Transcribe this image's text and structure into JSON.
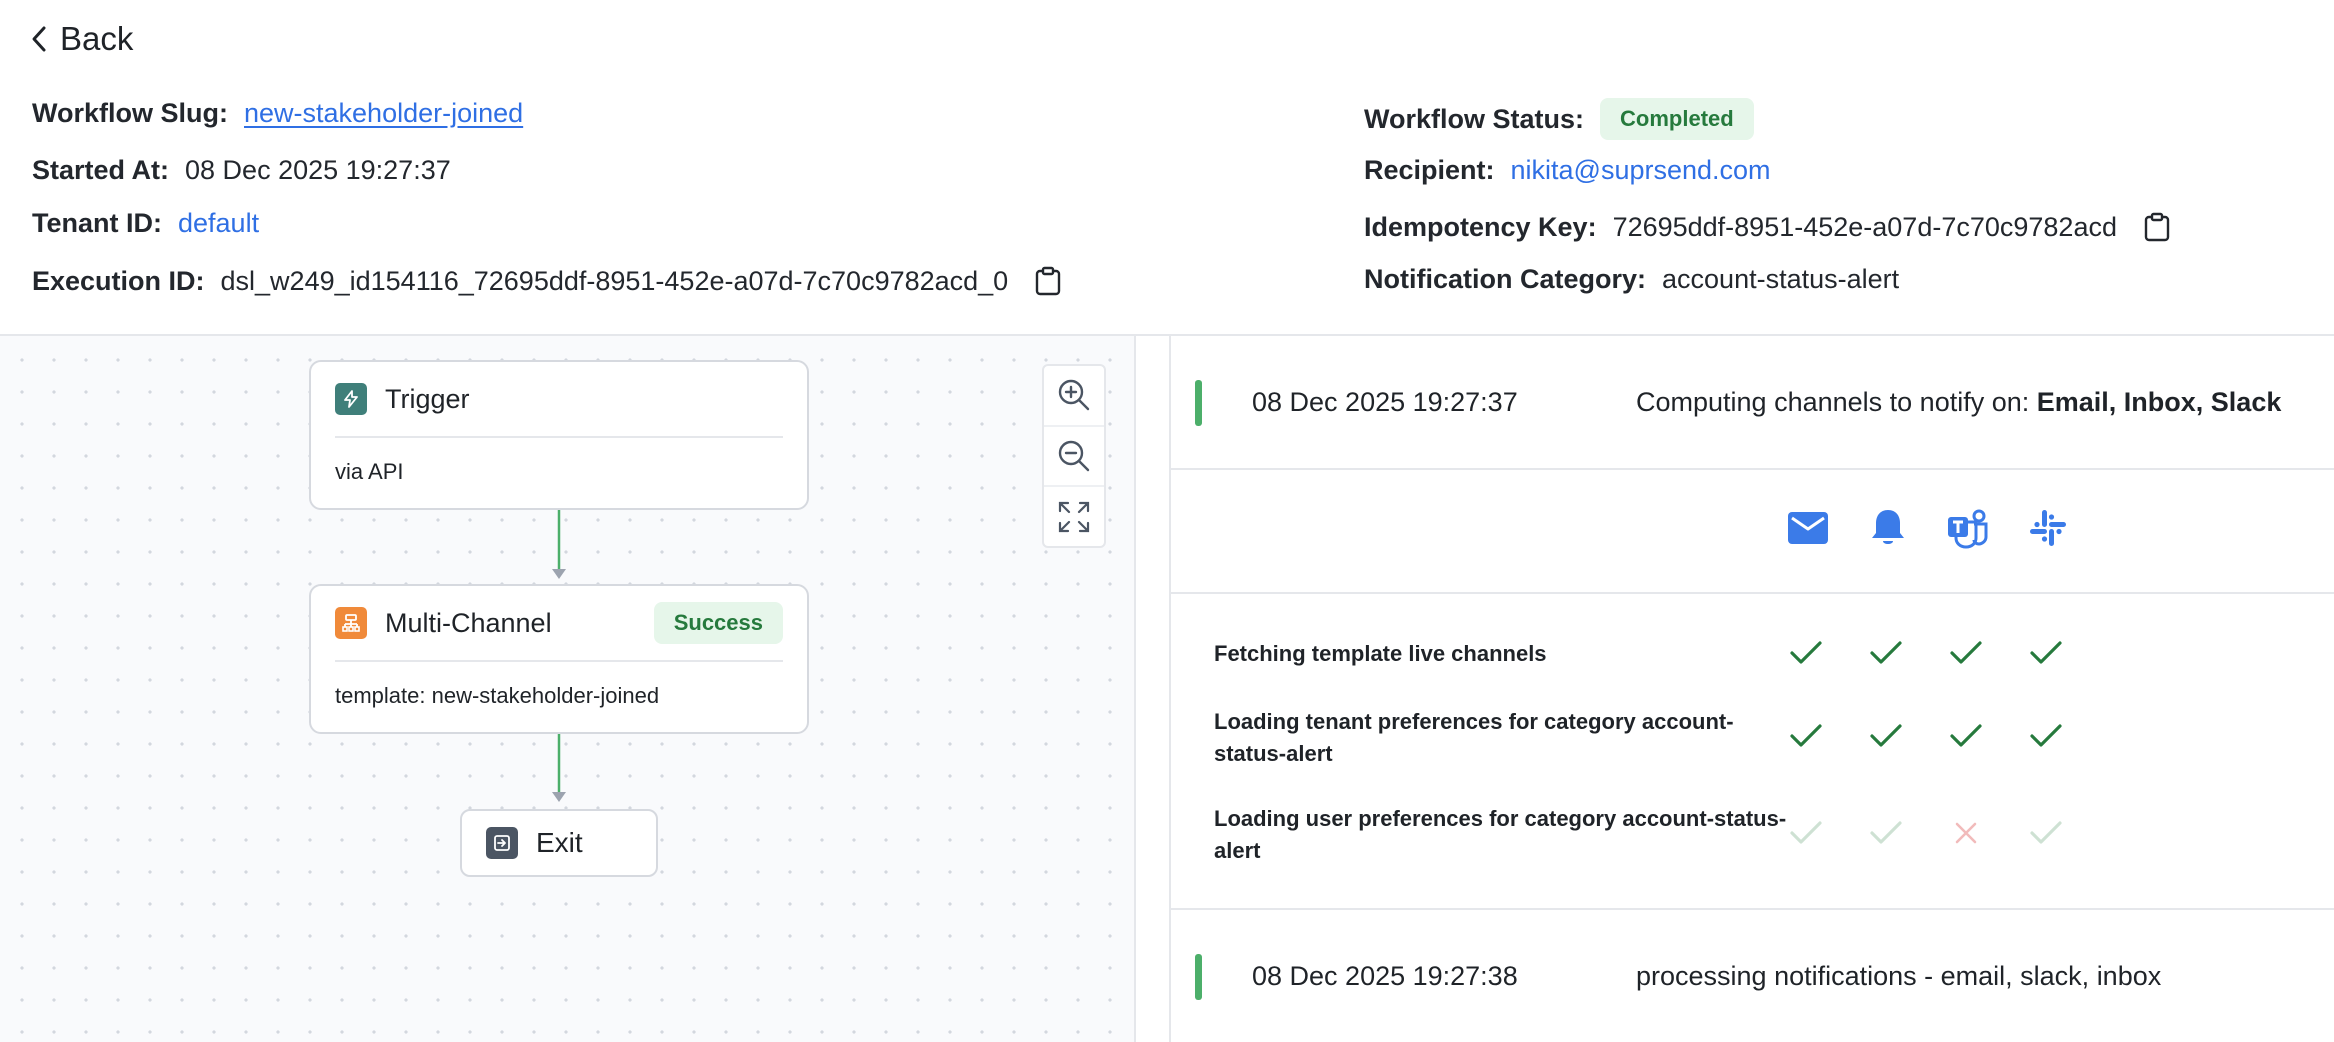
{
  "header": {
    "back_label": "Back",
    "workflow_slug": {
      "label": "Workflow Slug:",
      "value": "new-stakeholder-joined"
    },
    "started_at": {
      "label": "Started At:",
      "value": "08 Dec 2025 19:27:37"
    },
    "tenant_id": {
      "label": "Tenant ID:",
      "value": "default"
    },
    "execution_id": {
      "label": "Execution ID:",
      "value": "dsl_w249_id154116_72695ddf-8951-452e-a07d-7c70c9782acd_0"
    },
    "workflow_status": {
      "label": "Workflow Status:",
      "value": "Completed"
    },
    "recipient": {
      "label": "Recipient:",
      "value": "nikita@suprsend.com"
    },
    "idempotency_key": {
      "label": "Idempotency Key:",
      "value": "72695ddf-8951-452e-a07d-7c70c9782acd"
    },
    "notification_category": {
      "label": "Notification Category:",
      "value": "account-status-alert"
    }
  },
  "canvas": {
    "nodes": [
      {
        "title": "Trigger",
        "body": "via API",
        "icon": "lightning-icon",
        "icon_color": "#3f7f7a"
      },
      {
        "title": "Multi-Channel",
        "body": "template: new-stakeholder-joined",
        "badge": "Success",
        "icon": "multi-channel-icon",
        "icon_color": "#f08a3a"
      },
      {
        "title": "Exit",
        "icon": "exit-icon",
        "icon_color": "#4b5563"
      }
    ],
    "controls": [
      "zoom-in-icon",
      "zoom-out-icon",
      "fit-view-icon"
    ],
    "edge_color": "#4caf6a"
  },
  "log": {
    "entries": [
      {
        "time": "08 Dec 2025 19:27:37",
        "text_prefix": "Computing channels to notify on: ",
        "text_bold": "Email, Inbox, Slack"
      },
      {
        "time": "08 Dec 2025 19:27:38",
        "text_prefix": "processing notifications - email, slack, inbox",
        "text_bold": ""
      }
    ],
    "channel_icons": [
      "email-icon",
      "inbox-bell-icon",
      "teams-icon",
      "slack-icon"
    ],
    "checks": [
      {
        "label": "Fetching template live channels",
        "results": [
          "pass",
          "pass",
          "pass",
          "pass"
        ]
      },
      {
        "label": "Loading tenant preferences for category account-status-alert",
        "results": [
          "pass",
          "pass",
          "pass",
          "pass"
        ]
      },
      {
        "label": "Loading user preferences for category account-status-alert",
        "results": [
          "pass-faded",
          "pass-faded",
          "fail-faded",
          "pass-faded"
        ]
      }
    ],
    "colors": {
      "accent": "#2f6fe4",
      "success": "#267a3d",
      "bar": "#4caf6a",
      "icon_blue": "#3b7be8"
    }
  }
}
